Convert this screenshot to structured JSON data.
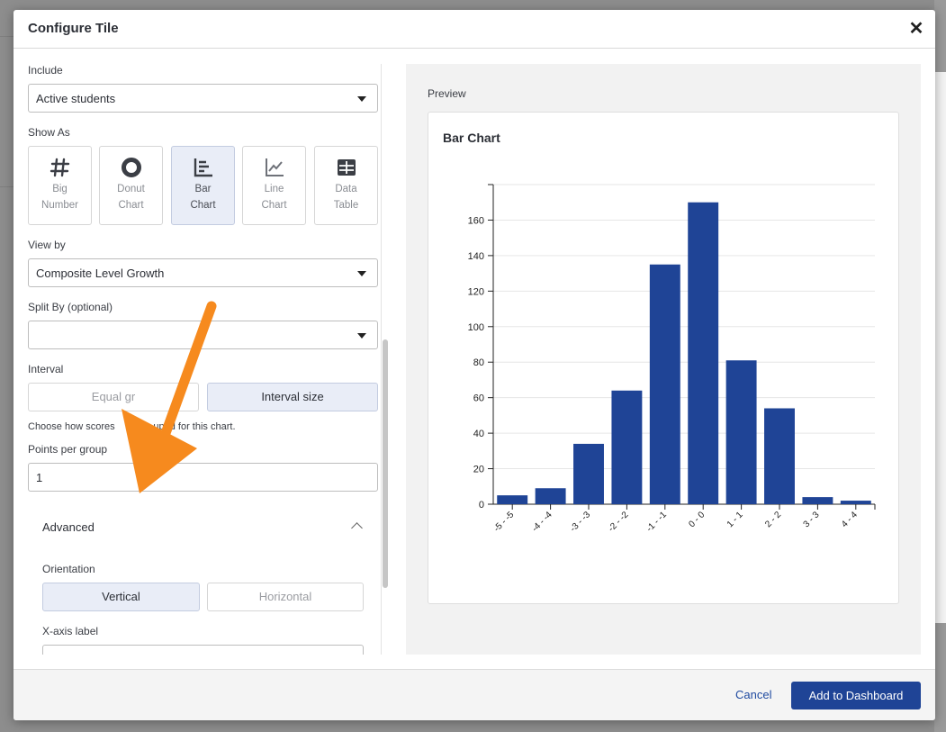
{
  "modal": {
    "title": "Configure Tile"
  },
  "form": {
    "include": {
      "label": "Include",
      "value": "Active students"
    },
    "show_as": {
      "label": "Show As",
      "options": [
        {
          "label_line1": "Big",
          "label_line2": "Number",
          "icon": "hash-icon",
          "selected": false
        },
        {
          "label_line1": "Donut",
          "label_line2": "Chart",
          "icon": "donut-icon",
          "selected": false
        },
        {
          "label_line1": "Bar",
          "label_line2": "Chart",
          "icon": "bar-chart-icon",
          "selected": true
        },
        {
          "label_line1": "Line",
          "label_line2": "Chart",
          "icon": "line-chart-icon",
          "selected": false
        },
        {
          "label_line1": "Data",
          "label_line2": "Table",
          "icon": "table-icon",
          "selected": false
        }
      ]
    },
    "view_by": {
      "label": "View by",
      "value": "Composite Level Growth"
    },
    "split_by": {
      "label": "Split By (optional)",
      "value": ""
    },
    "interval": {
      "label": "Interval",
      "option_equal": "Equal gr",
      "option_size": "Interval size",
      "selected": "Interval size",
      "hint": "Choose how scores              uped for this chart."
    },
    "points_per_group": {
      "label": "Points per group",
      "value": "1"
    },
    "advanced": {
      "title": "Advanced"
    },
    "orientation": {
      "label": "Orientation",
      "vertical": "Vertical",
      "horizontal": "Horizontal",
      "selected": "Vertical"
    },
    "x_axis_label": {
      "label": "X-axis label",
      "value": ""
    }
  },
  "preview": {
    "label": "Preview",
    "chart_title": "Bar Chart"
  },
  "chart_data": {
    "type": "bar",
    "title": "Bar Chart",
    "categories": [
      "-5 - -5",
      "-4 - -4",
      "-3 - -3",
      "-2 - -2",
      "-1 - -1",
      "0 - 0",
      "1 - 1",
      "2 - 2",
      "3 - 3",
      "4 - 4"
    ],
    "values": [
      5,
      9,
      34,
      64,
      135,
      170,
      81,
      54,
      4,
      2
    ],
    "yticks": [
      0,
      20,
      40,
      60,
      80,
      100,
      120,
      140,
      160
    ],
    "ylim": [
      0,
      180
    ],
    "bar_color": "#1f4496",
    "grid": true
  },
  "footer": {
    "cancel": "Cancel",
    "add": "Add to Dashboard"
  },
  "colors": {
    "accent": "#1f4496",
    "selected_bg": "#e9edf7",
    "annotation_arrow": "#f68a1e"
  }
}
